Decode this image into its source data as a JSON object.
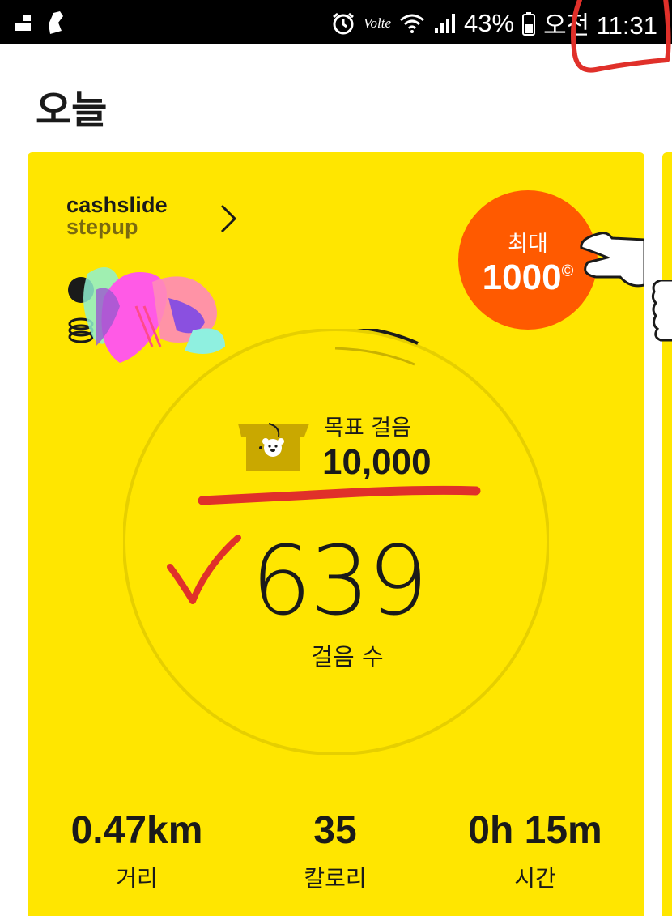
{
  "status_bar": {
    "volte": "Volte",
    "battery": "43%",
    "time": "오전 11:31"
  },
  "page": {
    "title": "오늘"
  },
  "card": {
    "brand_line1": "cashslide",
    "brand_line2": "stepup",
    "promo": {
      "label": "최대",
      "value": "1000",
      "unit": "©"
    },
    "goal": {
      "label": "목표 걸음",
      "value": "10,000"
    },
    "steps": {
      "value": "639",
      "label": "걸음 수"
    },
    "stats": [
      {
        "value": "0.47km",
        "label": "거리"
      },
      {
        "value": "35",
        "label": "칼로리"
      },
      {
        "value": "0h 15m",
        "label": "시간"
      }
    ]
  },
  "colors": {
    "card": "#ffe600",
    "badge": "#ff5a00",
    "annotation": "#e0302a"
  }
}
